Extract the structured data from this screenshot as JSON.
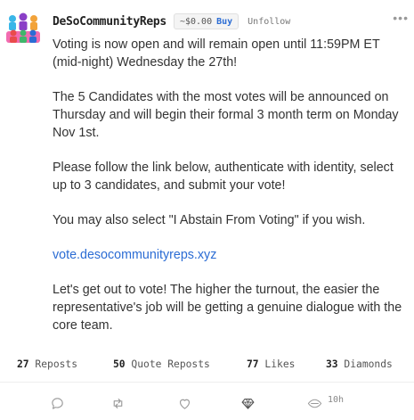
{
  "post": {
    "username": "DeSoCommunityReps",
    "price": "~$0.00",
    "buy_label": "Buy",
    "unfollow_label": "Unfollow",
    "more_label": "•••",
    "body": {
      "p1": "Voting is now open and will remain open until 11:59PM ET (mid-night) Wednesday the 27th!",
      "p2": "The 5 Candidates with the most votes will be announced on Thursday and will begin their formal 3 month term on Monday Nov 1st.",
      "p3": "Please follow the link below, authenticate with identity, select up to 3 candidates, and submit your vote!",
      "p4": "You may also select \"I Abstain From Voting\" if you wish.",
      "link": "vote.desocommunityreps.xyz",
      "p5": "Let's get out to vote! The higher the turnout, the easier the representative's job will be getting a genuine dialogue with the core team."
    },
    "stats": {
      "reposts_count": "27",
      "reposts_label": "Reposts",
      "quote_reposts_count": "50",
      "quote_reposts_label": "Quote Reposts",
      "likes_count": "77",
      "likes_label": "Likes",
      "diamonds_count": "33",
      "diamonds_label": "Diamonds"
    },
    "timestamp": "10h"
  },
  "icons": {
    "avatar": "community-people-avatar",
    "comment": "comment-icon",
    "repost": "repost-icon",
    "like": "heart-icon",
    "diamond": "diamond-icon",
    "views": "eye-icon",
    "more": "more-dots-icon"
  },
  "colors": {
    "link": "#2b6cd4",
    "text": "#333333",
    "muted": "#999999"
  }
}
